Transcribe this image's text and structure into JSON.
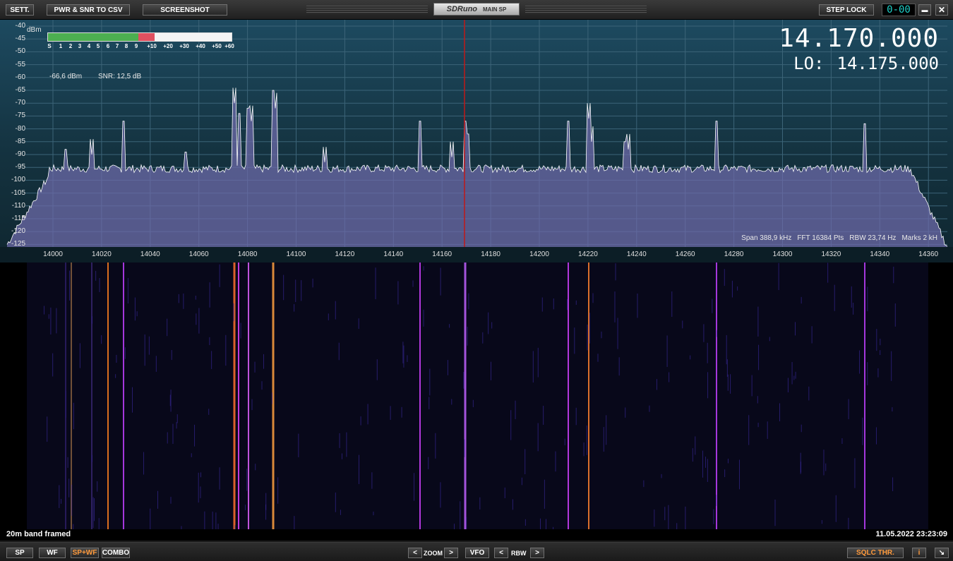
{
  "toolbar": {
    "sett": "SETT.",
    "pwr_snr_csv": "PWR & SNR TO CSV",
    "screenshot": "SCREENSHOT",
    "logo": "SDRuno",
    "main_sp": "MAIN SP",
    "step_lock": "STEP LOCK",
    "counter": "0-00",
    "minimize": "▬",
    "close": "✕"
  },
  "spectrum": {
    "dbm_label": "dBm",
    "db_ticks": [
      "-40",
      "-45",
      "-50",
      "-55",
      "-60",
      "-65",
      "-70",
      "-75",
      "-80",
      "-85",
      "-90",
      "-95",
      "-100",
      "-105",
      "-110",
      "-115",
      "-120",
      "-125"
    ],
    "smeter_labels": [
      "S",
      "1",
      "2",
      "3",
      "4",
      "5",
      "6",
      "7",
      "8",
      "9",
      "+10",
      "+20",
      "+30",
      "+40",
      "+50",
      "+60"
    ],
    "smeter_level_fraction": 0.58,
    "power_reading": "-66,6 dBm",
    "snr_reading": "SNR: 12,5 dB",
    "vfo_frequency": "14.170.000",
    "lo_label": "LO:",
    "lo_frequency": "14.175.000",
    "span": "Span 388,9 kHz",
    "fft": "FFT 16384 Pts",
    "rbw": "RBW 23,74 Hz",
    "marks": "Marks 2 kH",
    "freq_ticks": [
      "14000",
      "14020",
      "14040",
      "14060",
      "14080",
      "14100",
      "14120",
      "14140",
      "14160",
      "14180",
      "14200",
      "14220",
      "14240",
      "14260",
      "14280",
      "14300",
      "14320",
      "14340",
      "14360"
    ],
    "colors": {
      "trace": "#ffffff",
      "fill": "#6c6aa8",
      "vfo_line": "#c01818",
      "smeter_green": "#4caf50",
      "smeter_red": "#e05060"
    }
  },
  "status": {
    "left": "20m band framed",
    "right": "11.05.2022 23:23:09"
  },
  "bottom": {
    "sp": "SP",
    "wf": "WF",
    "spwf": "SP+WF",
    "combo": "COMBO",
    "zoom_left": "<",
    "zoom": "ZOOM",
    "zoom_right": ">",
    "vfo": "VFO",
    "rbw_left": "<",
    "rbw": "RBW",
    "rbw_right": ">",
    "sqlc": "SQLC THR.",
    "info": "i",
    "resize": "↘"
  }
}
